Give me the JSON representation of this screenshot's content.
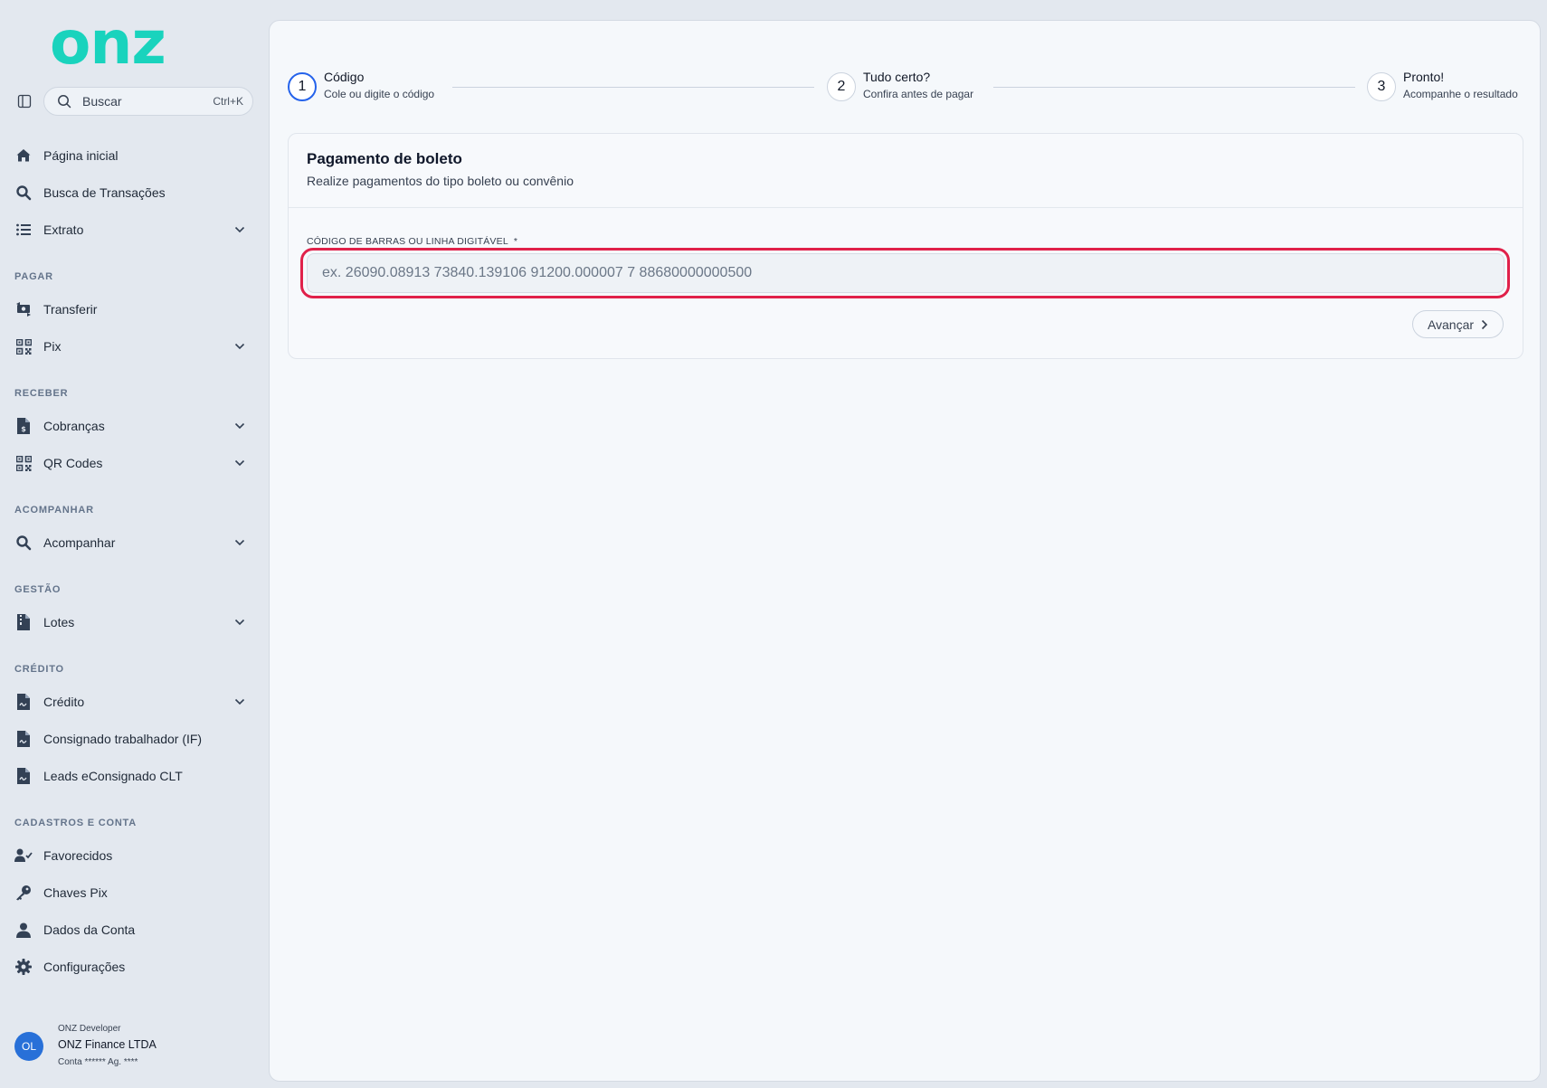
{
  "brand": {
    "logo_text": "onz",
    "accent": "#19d3bd"
  },
  "sidebar": {
    "search": {
      "label": "Buscar",
      "shortcut": "Ctrl+K"
    },
    "items": [
      {
        "label": "Página inicial",
        "icon": "home-icon"
      },
      {
        "label": "Busca de Transações",
        "icon": "search-icon"
      },
      {
        "label": "Extrato",
        "icon": "list-icon",
        "expandable": true
      }
    ],
    "sections": [
      {
        "title": "PAGAR",
        "items": [
          {
            "label": "Transferir",
            "icon": "money-transfer-icon"
          },
          {
            "label": "Pix",
            "icon": "qr-code-icon",
            "expandable": true
          }
        ]
      },
      {
        "title": "RECEBER",
        "items": [
          {
            "label": "Cobranças",
            "icon": "invoice-dollar-icon",
            "expandable": true
          },
          {
            "label": "QR Codes",
            "icon": "qr-code-icon",
            "expandable": true
          }
        ]
      },
      {
        "title": "ACOMPANHAR",
        "items": [
          {
            "label": "Acompanhar",
            "icon": "search-icon",
            "expandable": true
          }
        ]
      },
      {
        "title": "GESTÃO",
        "items": [
          {
            "label": "Lotes",
            "icon": "file-zip-icon",
            "expandable": true
          }
        ]
      },
      {
        "title": "CRÉDITO",
        "items": [
          {
            "label": "Crédito",
            "icon": "file-signature-icon",
            "expandable": true
          },
          {
            "label": "Consignado trabalhador (IF)",
            "icon": "file-signature-icon"
          },
          {
            "label": "Leads eConsignado CLT",
            "icon": "file-signature-icon"
          }
        ]
      },
      {
        "title": "CADASTROS E CONTA",
        "items": [
          {
            "label": "Favorecidos",
            "icon": "user-check-icon"
          },
          {
            "label": "Chaves Pix",
            "icon": "key-icon"
          },
          {
            "label": "Dados da Conta",
            "icon": "user-icon"
          },
          {
            "label": "Configurações",
            "icon": "gear-icon"
          }
        ]
      }
    ],
    "user": {
      "initials": "OL",
      "role": "ONZ Developer",
      "company": "ONZ Finance LTDA",
      "account": "Conta ****** Ag. ****",
      "avatar_color": "#2870d8"
    }
  },
  "stepper": {
    "active_color": "#2563eb",
    "steps": [
      {
        "number": "1",
        "title": "Código",
        "subtitle": "Cole ou digite o código",
        "active": true
      },
      {
        "number": "2",
        "title": "Tudo certo?",
        "subtitle": "Confira antes de pagar",
        "active": false
      },
      {
        "number": "3",
        "title": "Pronto!",
        "subtitle": "Acompanhe o resultado",
        "active": false
      }
    ]
  },
  "card": {
    "title": "Pagamento de boleto",
    "subtitle": "Realize pagamentos do tipo boleto ou convênio",
    "field_label": "CÓDIGO DE BARRAS OU LINHA DIGITÁVEL",
    "field_required_mark": "*",
    "field_value": "",
    "field_placeholder": "ex. 26090.08913 73840.139106 91200.000007 7 88680000000500",
    "highlight_color": "#e0214a",
    "next_button": "Avançar"
  }
}
